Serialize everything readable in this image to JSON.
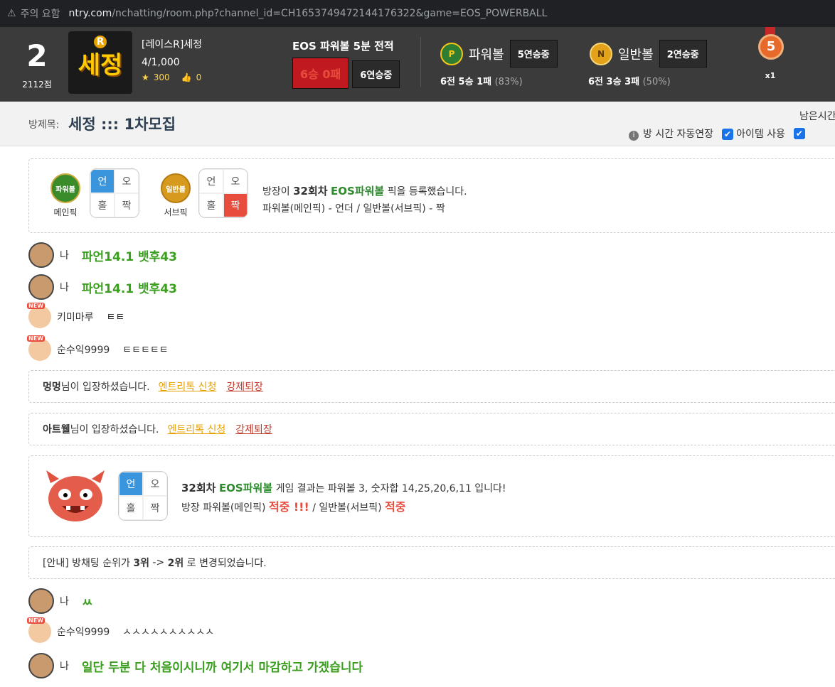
{
  "browser": {
    "warning": "주의 요함",
    "url_host": "ntry.com",
    "url_path": "/nchatting/room.php?channel_id=CH1653749472144176322&game=EOS_POWERBALL"
  },
  "header": {
    "rank": "2",
    "points": "2112점",
    "logo_text": "세정",
    "logo_badge": "R",
    "room_name": "[레이스R]세정",
    "members": "4/1,000",
    "stars": "300",
    "likes": "0",
    "eos_title": "EOS 파워볼 5분 전적",
    "eos_record": "6승 0패",
    "eos_streak": "6연승중",
    "powerball_label": "파워볼",
    "powerball_streak": "5연승중",
    "powerball_stats": "6전 5승 1패",
    "powerball_pct": "(83%)",
    "normalball_label": "일반볼",
    "normalball_streak": "2연승중",
    "normalball_stats": "6전 3승 3패",
    "normalball_pct": "(50%)",
    "medal_num": "5",
    "medal_count": "x1"
  },
  "roombar": {
    "label": "방제목:",
    "title": "세정 ::: 1차모집",
    "remain": "남은시간",
    "auto_extend": "방 시간 자동연장",
    "item_use": "아이템 사용"
  },
  "pick": {
    "main_ball": "파워볼",
    "main_label": "메인픽",
    "sub_ball": "일반볼",
    "sub_label": "서브픽",
    "cells": [
      "언",
      "오",
      "홀",
      "짝"
    ],
    "msg_prefix": "방장이",
    "msg_round": "32회차",
    "msg_game": "EOS파워볼",
    "msg_suffix": "픽을 등록했습니다.",
    "msg_line2": "파워볼(메인픽) - 언더 / 일반볼(서브픽) - 짝"
  },
  "messages": [
    {
      "who": "나",
      "text": "파언14.1 뱃후43"
    },
    {
      "who": "나",
      "text": "파언14.1 뱃후43"
    },
    {
      "who": "키미마루",
      "text": "ㅌㅌ"
    },
    {
      "who": "순수익9999",
      "text": "ㅌㅌㅌㅌㅌ"
    }
  ],
  "system": [
    {
      "name": "멍멍",
      "text": "님이 입장하셨습니다.",
      "entry": "엔트리톡 신청",
      "kick": "강제퇴장"
    },
    {
      "name": "아트웰",
      "text": "님이 입장하셨습니다.",
      "entry": "엔트리톡 신청",
      "kick": "강제퇴장"
    }
  ],
  "result": {
    "round": "32회차",
    "game": "EOS파워볼",
    "text1": "게임 결과는 파워볼 3, 숫자합 14,25,20,6,11 입니다!",
    "text2a": "방장 파워볼(메인픽)",
    "hit1": "적중 !!!",
    "text2b": "/ 일반볼(서브픽)",
    "hit2": "적중"
  },
  "notice": {
    "prefix": "[안내] 방채팅 순위가",
    "from": "3위",
    "arrow": "->",
    "to": "2위",
    "suffix": "로 변경되었습니다."
  },
  "messages2": [
    {
      "who": "나",
      "text": "ㅆ"
    },
    {
      "who": "순수익9999",
      "text": "ㅅㅅㅅㅅㅅㅅㅅㅅㅅㅅ"
    },
    {
      "who": "나",
      "text": "일단 두분 다 처음이시니까 여기서 마감하고 가겠습니다"
    }
  ]
}
